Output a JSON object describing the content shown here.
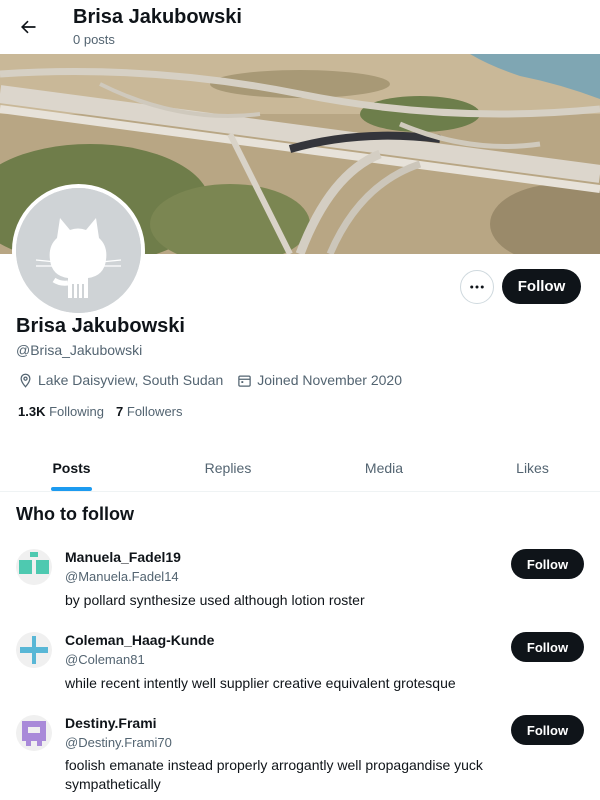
{
  "header": {
    "title": "Brisa Jakubowski",
    "subtitle": "0 posts",
    "back_icon": "arrow-left-icon"
  },
  "profile": {
    "name": "Brisa Jakubowski",
    "handle": "@Brisa_Jakubowski",
    "location": "Lake Daisyview, South Sudan",
    "joined": "Joined November 2020",
    "following_count": "1.3K",
    "following_label": "Following",
    "followers_count": "7",
    "followers_label": "Followers",
    "follow_label": "Follow",
    "avatar_icon": "github-octocat-icon"
  },
  "tabs": [
    {
      "label": "Posts",
      "active": true
    },
    {
      "label": "Replies",
      "active": false
    },
    {
      "label": "Media",
      "active": false
    },
    {
      "label": "Likes",
      "active": false
    }
  ],
  "who_to_follow": {
    "title": "Who to follow",
    "items": [
      {
        "name": "Manuela_Fadel19",
        "handle": "@Manuela.Fadel14",
        "bio": "by pollard synthesize used although lotion roster",
        "follow_label": "Follow",
        "avatar_color": "#4ec9b0"
      },
      {
        "name": "Coleman_Haag-Kunde",
        "handle": "@Coleman81",
        "bio": "while recent intently well supplier creative equivalent grotesque",
        "follow_label": "Follow",
        "avatar_color": "#59b7d6"
      },
      {
        "name": "Destiny.Frami",
        "handle": "@Destiny.Frami70",
        "bio": "foolish emanate instead properly arrogantly well propagandise yuck sympathetically",
        "follow_label": "Follow",
        "avatar_color": "#a98ad9"
      }
    ]
  },
  "colors": {
    "accent": "#1d9bf0",
    "button": "#0f1419",
    "secondary_text": "#536471"
  }
}
